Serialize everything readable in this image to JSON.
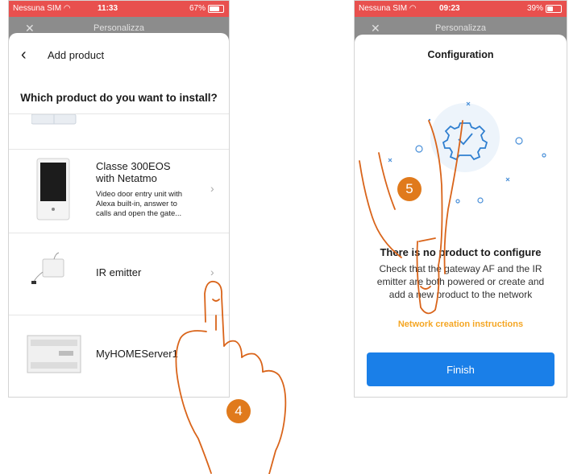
{
  "left_phone": {
    "status": {
      "carrier": "Nessuna SIM",
      "time": "11:33",
      "battery": "67%",
      "battery_level": 0.67
    },
    "behind_title": "Personalizza",
    "header_title": "Add product",
    "question": "Which product do you want to install?",
    "products": [
      {
        "name": "Classe 300EOS\nwith Netatmo",
        "desc": "Video door entry unit with\nAlexa built-in, answer to\ncalls and open the gate..."
      },
      {
        "name": "IR emitter",
        "desc": ""
      },
      {
        "name": "MyHOMEServer1",
        "desc": ""
      }
    ]
  },
  "right_phone": {
    "status": {
      "carrier": "Nessuna SIM",
      "time": "09:23",
      "battery": "39%",
      "battery_level": 0.39
    },
    "behind_title": "Personalizza",
    "title": "Configuration",
    "message_title": "There is no product to configure",
    "message_body": "Check that the gateway AF and the IR emitter are both powered or create and add a new product to the network",
    "link": "Network creation instructions",
    "finish_label": "Finish"
  },
  "steps": {
    "left": "4",
    "right": "5"
  },
  "colors": {
    "status_bar": "#e8504e",
    "accent_orange": "#f5a623",
    "button_blue": "#1a7fe8",
    "hand_outline": "#d9641a",
    "badge": "#e07a1c"
  }
}
